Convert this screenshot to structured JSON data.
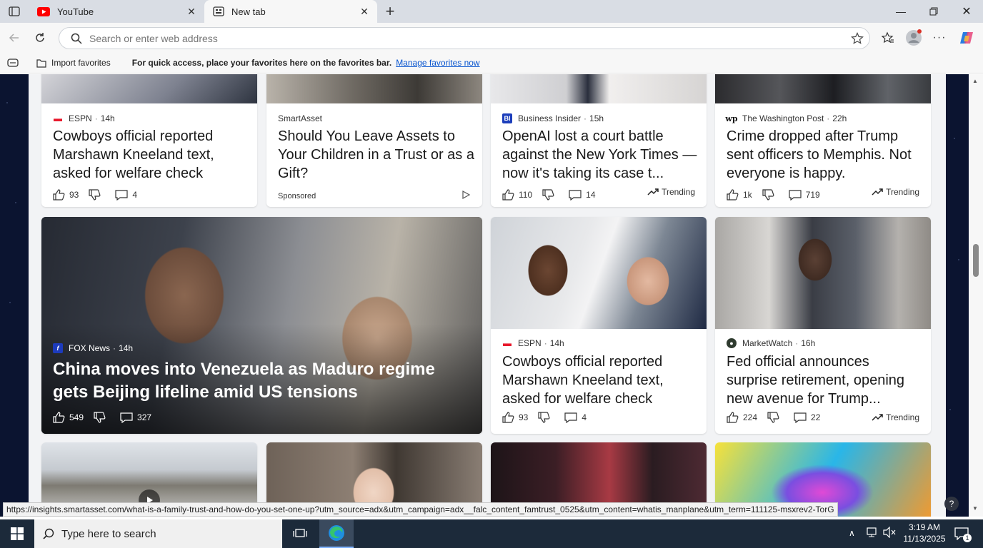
{
  "browser": {
    "tabs": [
      {
        "title": "YouTube",
        "icon": "youtube-icon",
        "active": false
      },
      {
        "title": "New tab",
        "icon": "newtab-icon",
        "active": true
      }
    ],
    "address_placeholder": "Search or enter web address",
    "favorites_bar": {
      "import_label": "Import favorites",
      "hint": "For quick access, place your favorites here on the favorites bar.",
      "manage_link": "Manage favorites now"
    },
    "status_url": "https://insights.smartasset.com/what-is-a-family-trust-and-how-do-you-set-one-up?utm_source=adx&utm_campaign=adx__falc_content_famtrust_0525&utm_content=whatis_manplane&utm_term=111125-msxrev2-TorG"
  },
  "feed": {
    "row1": [
      {
        "source": "ESPN",
        "time": "14h",
        "headline": "Cowboys official reported Marshawn Kneeland text, asked for welfare check",
        "likes": "93",
        "comments": "4",
        "trending": false,
        "logo_color": "#e8192c"
      },
      {
        "source": "SmartAsset",
        "time": "",
        "headline": "Should You Leave Assets to Your Children in a Trust or as a Gift?",
        "sponsored": "Sponsored"
      },
      {
        "source": "Business Insider",
        "time": "15h",
        "headline": "OpenAI lost a court battle against the New York Times — now it's taking its case t...",
        "likes": "110",
        "comments": "14",
        "trending": "Trending",
        "logo_color": "#1d3fbb"
      },
      {
        "source": "The Washington Post",
        "time": "22h",
        "headline": "Crime dropped after Trump sent officers to Memphis. Not everyone is happy.",
        "likes": "1k",
        "comments": "719",
        "trending": "Trending",
        "logo_color": "#111111"
      }
    ],
    "hero": {
      "source": "FOX News",
      "time": "14h",
      "headline": "China moves into Venezuela as Maduro regime gets Beijing lifeline amid US tensions",
      "likes": "549",
      "comments": "327"
    },
    "row2": [
      {
        "source": "ESPN",
        "time": "14h",
        "headline": "Cowboys official reported Marshawn Kneeland text, asked for welfare check",
        "likes": "93",
        "comments": "4",
        "trending": false,
        "logo_color": "#e8192c"
      },
      {
        "source": "MarketWatch",
        "time": "16h",
        "headline": "Fed official announces surprise retirement, opening new avenue for Trump...",
        "likes": "224",
        "comments": "22",
        "trending": "Trending",
        "logo_color": "#2f3b2f"
      }
    ]
  },
  "taskbar": {
    "search_placeholder": "Type here to search",
    "time": "3:19 AM",
    "date": "11/13/2025",
    "notification_count": "1"
  },
  "colors": {
    "accent_link": "#0b57d0",
    "taskbar": "#1c2a3a"
  }
}
